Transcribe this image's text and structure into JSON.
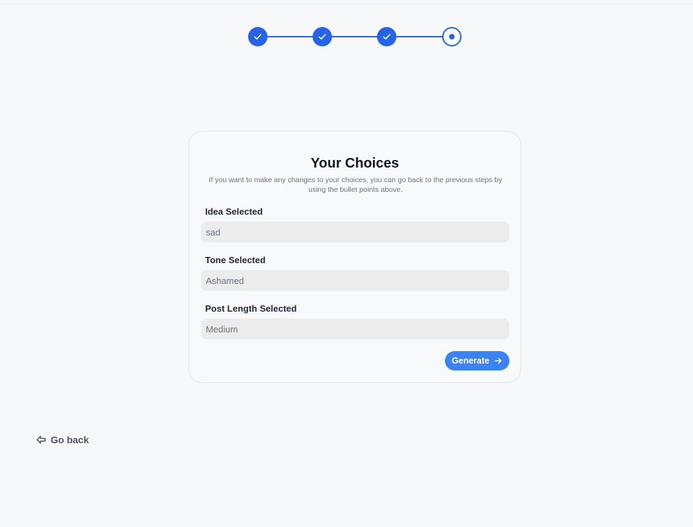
{
  "stepper": {
    "steps": [
      {
        "status": "complete"
      },
      {
        "status": "complete"
      },
      {
        "status": "complete"
      },
      {
        "status": "current"
      }
    ],
    "accent_color": "#2563eb"
  },
  "card": {
    "title": "Your Choices",
    "subtitle": "If you want to make any changes to your choices, you can go back to the previous steps by using the bullet points above.",
    "fields": {
      "idea": {
        "label": "Idea Selected",
        "value": "sad"
      },
      "tone": {
        "label": "Tone Selected",
        "value": "Ashamed"
      },
      "length": {
        "label": "Post Length Selected",
        "value": "Medium"
      }
    },
    "generate_button": {
      "label": "Generate",
      "icon": "arrow-right-icon",
      "color": "#3b82f6"
    }
  },
  "footer": {
    "go_back_label": "Go back",
    "go_back_icon": "arrow-left-icon"
  }
}
